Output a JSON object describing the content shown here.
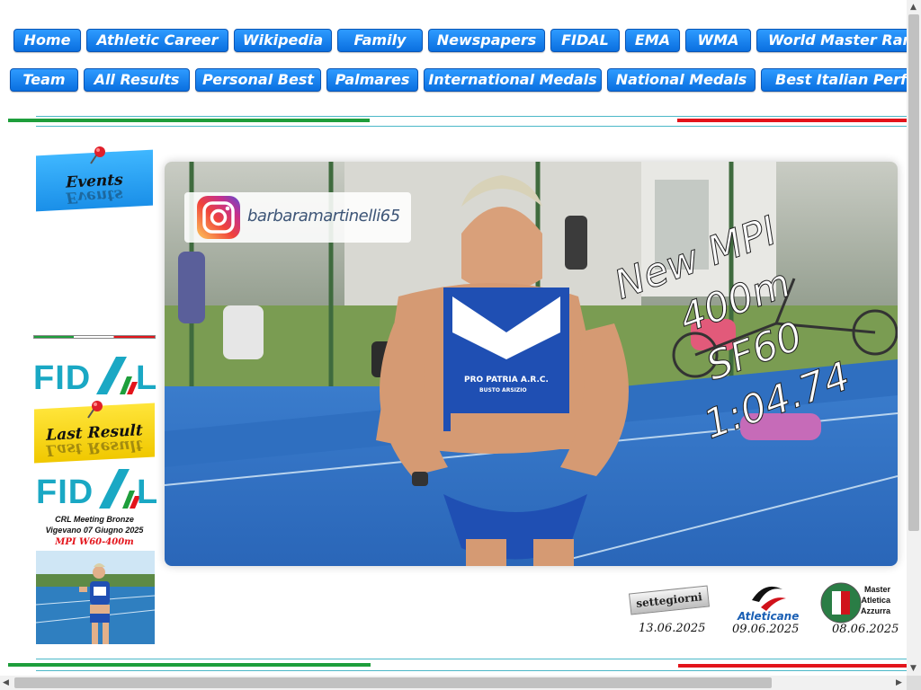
{
  "nav": {
    "row1": [
      "Home",
      "Athletic Career",
      "Wikipedia",
      "Family",
      "Newspapers",
      "FIDAL",
      "EMA",
      "WMA",
      "World Master Rankings"
    ],
    "row2": [
      "Team",
      "All Results",
      "Personal Best",
      "Palmares",
      "International Medals",
      "National Medals",
      "Best Italian Performances"
    ]
  },
  "sidebar": {
    "events_label": "Events",
    "last_result_label": "Last Result",
    "fidal_logo": "FIDAL",
    "caption_line1": "CRL Meeting Bronze",
    "caption_line2": "Vigevano 07 Giugno 2025",
    "caption_line3": "MPI  W60-400m"
  },
  "hero": {
    "instagram_handle": "barbaramartinelli65",
    "overlay_lines": [
      "New MPI",
      "400m",
      "SF60",
      "1:04.74"
    ],
    "bib_text": "PRO PATRIA A.R.C.",
    "bib_sub": "BUSTO ARSIZIO"
  },
  "news": [
    {
      "source": "settegiorni",
      "date": "13.06.2025"
    },
    {
      "source": "Atleticanet.it",
      "date": "09.06.2025"
    },
    {
      "source": "Master Atletica Azzurra",
      "date": "08.06.2025"
    }
  ],
  "colors": {
    "nav_button": "#0a6fe0",
    "green": "#1e9e3c",
    "red": "#e3141b",
    "teal": "#1aa8c4"
  },
  "icons": [
    "instagram-icon",
    "pushpin-icon"
  ]
}
